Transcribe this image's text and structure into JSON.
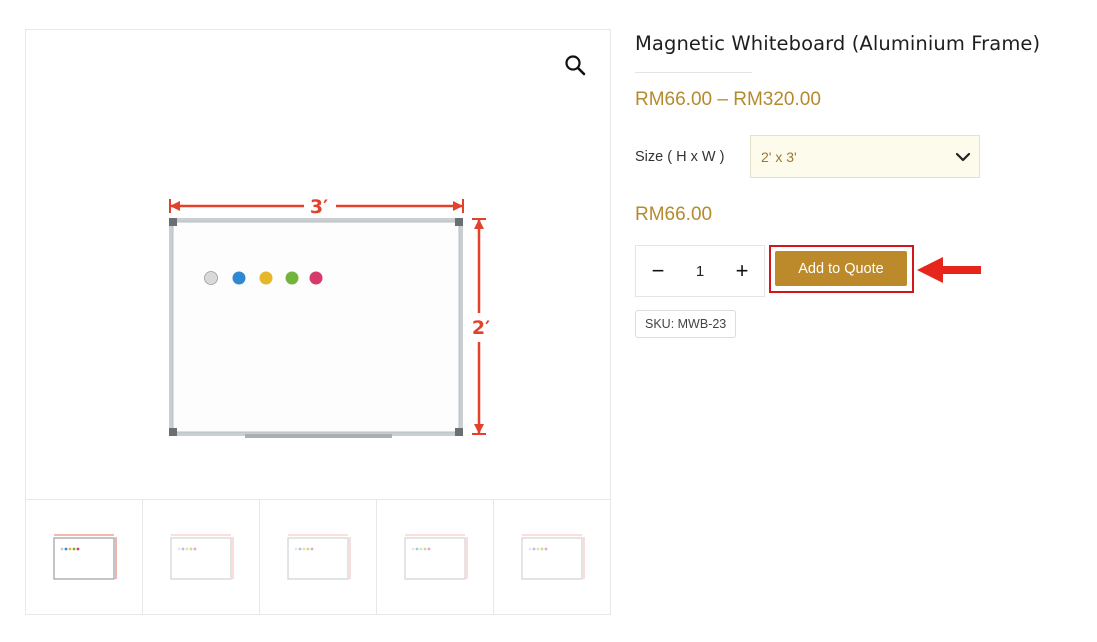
{
  "product": {
    "title": "Magnetic Whiteboard (Aluminium Frame)",
    "price_range": "RM66.00 – RM320.00",
    "variation": {
      "label": "Size ( H x W )",
      "selected": "2' x 3'"
    },
    "price": "RM66.00",
    "quantity": "1",
    "quantity_minus_symbol": "−",
    "quantity_plus_symbol": "+",
    "add_to_quote_label": "Add to Quote",
    "sku": "SKU: MWB-23"
  },
  "gallery": {
    "width_label": "3′",
    "height_label": "2′",
    "thumbnail_count": 5,
    "active_thumbnail": 1
  },
  "icons": {
    "zoom": "magnifier-icon",
    "select": "chevron-down-icon",
    "callout": "red-arrow-left-icon"
  },
  "colors": {
    "accent_gold": "#bc8a2b",
    "price_gold": "#b58a2e",
    "dimension_red": "#e2412b",
    "highlight_red": "#d3151c",
    "select_bg": "#fdfbeb",
    "magnets": [
      "#d9d9d9",
      "#2f88d2",
      "#e6b72a",
      "#72b53a",
      "#d63a6a"
    ]
  }
}
